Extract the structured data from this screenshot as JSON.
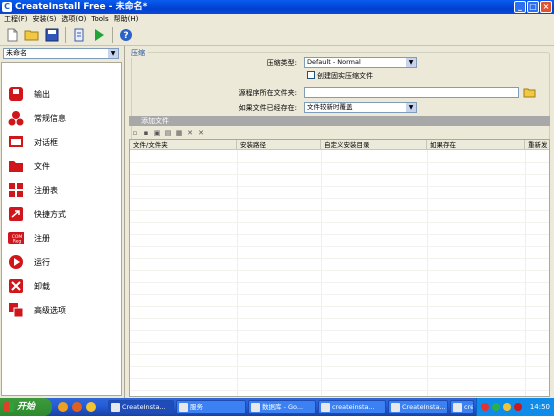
{
  "window": {
    "title": "CreateInstall Free - 未命名*"
  },
  "menu": [
    "工程(F)",
    "安装(S)",
    "选项(O)",
    "Tools",
    "帮助(H)"
  ],
  "toolbar": {
    "icons": [
      "new-file-icon",
      "open-folder-icon",
      "save-icon",
      "build-icon",
      "run-icon",
      "help-icon"
    ]
  },
  "project_select": {
    "value": "未命名"
  },
  "nav_items": [
    {
      "label": "输出",
      "icon": "output-icon",
      "color": "#d0151b"
    },
    {
      "label": "常规信息",
      "icon": "general-info-icon",
      "color": "#d0151b"
    },
    {
      "label": "对话框",
      "icon": "dialog-icon",
      "color": "#d0151b"
    },
    {
      "label": "文件",
      "icon": "folder-icon",
      "color": "#d0151b"
    },
    {
      "label": "注册表",
      "icon": "registry-icon",
      "color": "#d0151b"
    },
    {
      "label": "快捷方式",
      "icon": "shortcut-icon",
      "color": "#d0151b"
    },
    {
      "label": "注册",
      "icon": "com-register-icon",
      "color": "#d0151b"
    },
    {
      "label": "运行",
      "icon": "run-icon",
      "color": "#d0151b"
    },
    {
      "label": "卸载",
      "icon": "uninstall-icon",
      "color": "#d0151b"
    },
    {
      "label": "高级选项",
      "icon": "advanced-icon",
      "color": "#d0151b"
    }
  ],
  "compress": {
    "section_label": "压缩",
    "type_label": "压缩类型:",
    "type_value": "Default - Normal",
    "create_compressed_label": "创建固实压缩文件",
    "create_compressed_checked": false,
    "program_folder_label": "源程序所在文件夹:",
    "program_folder_value": "",
    "if_exists_label": "如果文件已经存在:",
    "if_exists_value": "文件较新时覆盖"
  },
  "files": {
    "add_label": "添加文件",
    "toolbar_icons": [
      "add-file-icon",
      "add-folder-icon",
      "copy-icon",
      "paste-icon",
      "properties-icon",
      "delete-icon",
      "remove-icon"
    ],
    "columns": [
      "文件/文件夹",
      "安装路径",
      "自定义安装目录",
      "如果存在",
      "重新发"
    ]
  },
  "taskbar": {
    "start_label": "开始",
    "tasks": [
      "CreateInsta...",
      "服务",
      "数据库 - Go...",
      "createinsta...",
      "CreateInsta...",
      "createinsta..."
    ],
    "clock": "14:50"
  },
  "colors": {
    "accent": "#245edb",
    "brand_red": "#d0151b"
  }
}
